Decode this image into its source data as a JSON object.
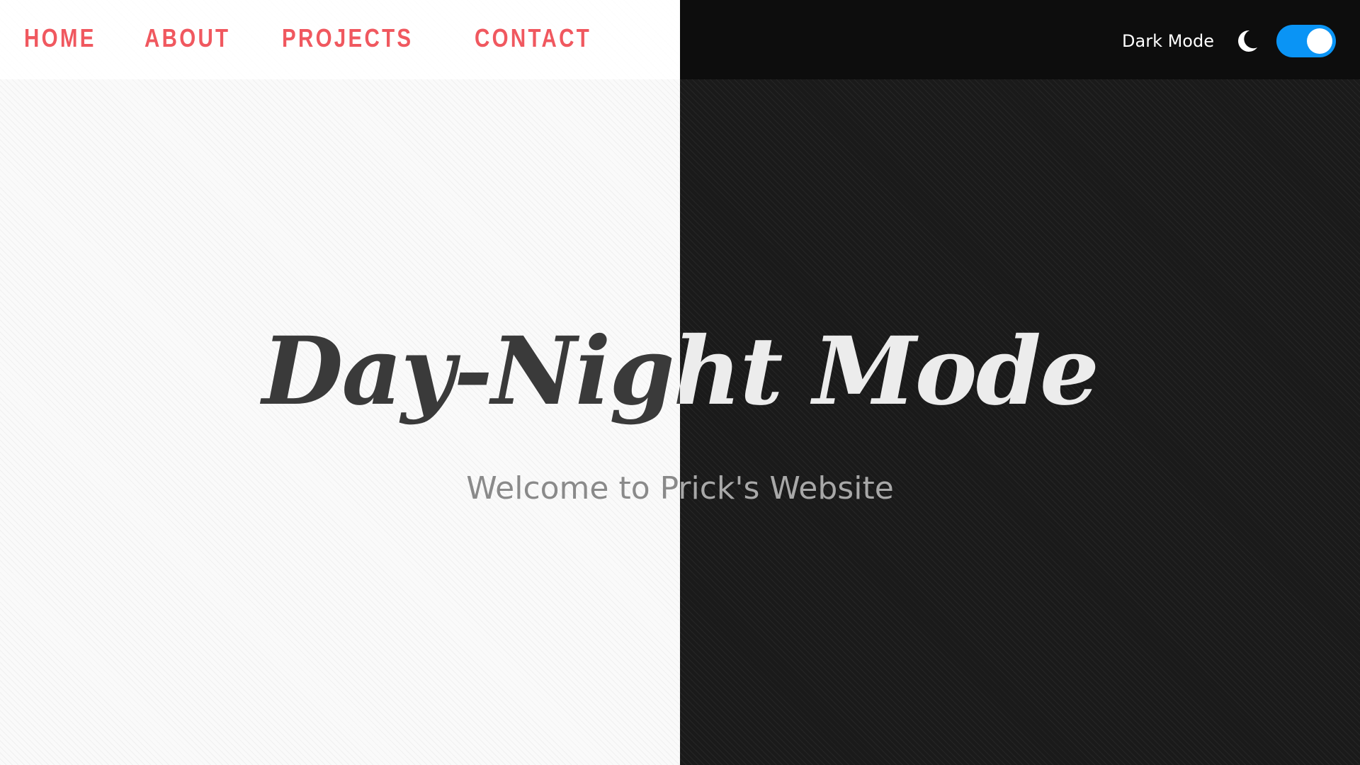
{
  "nav": {
    "items": [
      {
        "label": "HOME"
      },
      {
        "label": "ABOUT"
      },
      {
        "label": "PROJECTS"
      },
      {
        "label": "CONTACT"
      }
    ]
  },
  "controls": {
    "mode_label": "Dark Mode",
    "icon": "moon-icon",
    "toggle_on": true
  },
  "hero": {
    "title": "Day-Night Mode",
    "subtitle": "Welcome to Prick's Website"
  },
  "colors": {
    "nav_link": "#f0585f",
    "toggle_on": "#0a94f5",
    "light_bg": "#fafafa",
    "dark_bg": "#1a1a1a"
  }
}
